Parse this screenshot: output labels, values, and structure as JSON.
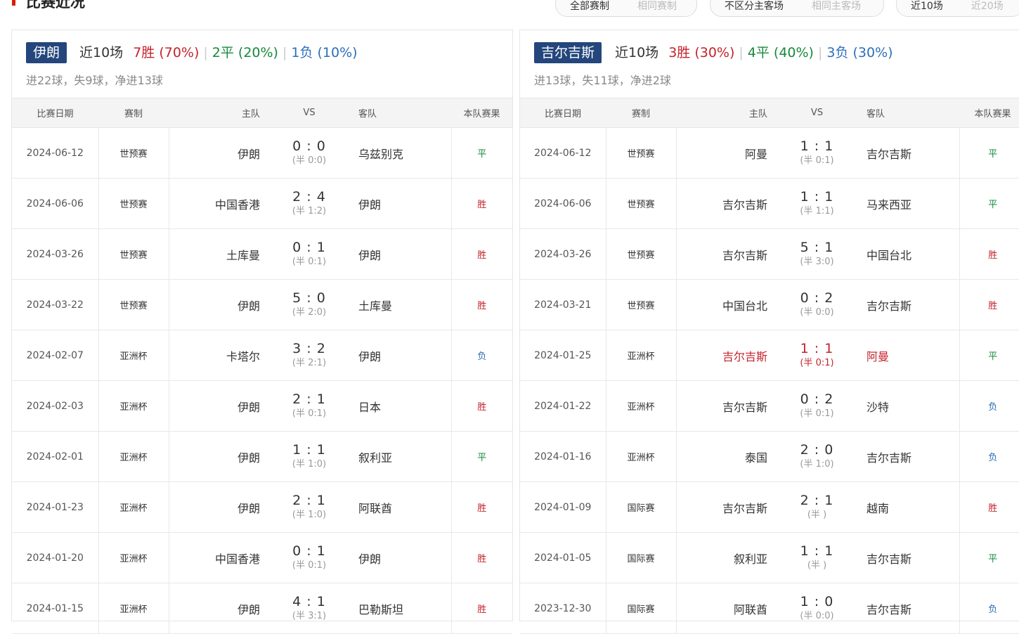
{
  "section_title": "比赛近况",
  "filters": {
    "group1": [
      "全部赛制",
      "相同赛制"
    ],
    "group2": [
      "不区分主客场",
      "相同主客场"
    ],
    "group3": [
      "近10场",
      "近20场"
    ]
  },
  "colors": {
    "win": "#c4232c",
    "draw": "#16893c",
    "loss": "#2d6fb8",
    "badge": "#24467c",
    "accent": "#d81e06"
  },
  "columns": {
    "date": "比赛日期",
    "comp": "赛制",
    "home": "主队",
    "vs": "VS",
    "away": "客队",
    "result": "本队赛果"
  },
  "left": {
    "team": "伊朗",
    "recent": "近10场",
    "wins": "7胜 (70%)",
    "draws": "2平 (20%)",
    "losses": "1负 (10%)",
    "goals": "进22球，失9球，净进13球",
    "matches": [
      {
        "date": "2024-06-12",
        "comp": "世预赛",
        "home": "伊朗",
        "score": "0 : 0",
        "half": "(半 0:0)",
        "away": "乌兹别克",
        "result": "平",
        "type": "draw"
      },
      {
        "date": "2024-06-06",
        "comp": "世预赛",
        "home": "中国香港",
        "score": "2 : 4",
        "half": "(半 1:2)",
        "away": "伊朗",
        "result": "胜",
        "type": "win"
      },
      {
        "date": "2024-03-26",
        "comp": "世预赛",
        "home": "土库曼",
        "score": "0 : 1",
        "half": "(半 0:1)",
        "away": "伊朗",
        "result": "胜",
        "type": "win"
      },
      {
        "date": "2024-03-22",
        "comp": "世预赛",
        "home": "伊朗",
        "score": "5 : 0",
        "half": "(半 2:0)",
        "away": "土库曼",
        "result": "胜",
        "type": "win"
      },
      {
        "date": "2024-02-07",
        "comp": "亚洲杯",
        "home": "卡塔尔",
        "score": "3 : 2",
        "half": "(半 2:1)",
        "away": "伊朗",
        "result": "负",
        "type": "loss"
      },
      {
        "date": "2024-02-03",
        "comp": "亚洲杯",
        "home": "伊朗",
        "score": "2 : 1",
        "half": "(半 0:1)",
        "away": "日本",
        "result": "胜",
        "type": "win"
      },
      {
        "date": "2024-02-01",
        "comp": "亚洲杯",
        "home": "伊朗",
        "score": "1 : 1",
        "half": "(半 1:0)",
        "away": "叙利亚",
        "result": "平",
        "type": "draw"
      },
      {
        "date": "2024-01-23",
        "comp": "亚洲杯",
        "home": "伊朗",
        "score": "2 : 1",
        "half": "(半 1:0)",
        "away": "阿联酋",
        "result": "胜",
        "type": "win"
      },
      {
        "date": "2024-01-20",
        "comp": "亚洲杯",
        "home": "中国香港",
        "score": "0 : 1",
        "half": "(半 0:1)",
        "away": "伊朗",
        "result": "胜",
        "type": "win"
      },
      {
        "date": "2024-01-15",
        "comp": "亚洲杯",
        "home": "伊朗",
        "score": "4 : 1",
        "half": "(半 3:1)",
        "away": "巴勒斯坦",
        "result": "胜",
        "type": "win"
      }
    ]
  },
  "right": {
    "team": "吉尔吉斯",
    "recent": "近10场",
    "wins": "3胜 (30%)",
    "draws": "4平 (40%)",
    "losses": "3负 (30%)",
    "goals": "进13球，失11球，净进2球",
    "matches": [
      {
        "date": "2024-06-12",
        "comp": "世预赛",
        "home": "阿曼",
        "score": "1 : 1",
        "half": "(半 0:1)",
        "away": "吉尔吉斯",
        "result": "平",
        "type": "draw"
      },
      {
        "date": "2024-06-06",
        "comp": "世预赛",
        "home": "吉尔吉斯",
        "score": "1 : 1",
        "half": "(半 1:1)",
        "away": "马来西亚",
        "result": "平",
        "type": "draw"
      },
      {
        "date": "2024-03-26",
        "comp": "世预赛",
        "home": "吉尔吉斯",
        "score": "5 : 1",
        "half": "(半 3:0)",
        "away": "中国台北",
        "result": "胜",
        "type": "win"
      },
      {
        "date": "2024-03-21",
        "comp": "世预赛",
        "home": "中国台北",
        "score": "0 : 2",
        "half": "(半 0:0)",
        "away": "吉尔吉斯",
        "result": "胜",
        "type": "win"
      },
      {
        "date": "2024-01-25",
        "comp": "亚洲杯",
        "home": "吉尔吉斯",
        "score": "1 : 1",
        "half": "(半 0:1)",
        "away": "阿曼",
        "result": "平",
        "type": "draw",
        "highlight": true
      },
      {
        "date": "2024-01-22",
        "comp": "亚洲杯",
        "home": "吉尔吉斯",
        "score": "0 : 2",
        "half": "(半 0:1)",
        "away": "沙特",
        "result": "负",
        "type": "loss"
      },
      {
        "date": "2024-01-16",
        "comp": "亚洲杯",
        "home": "泰国",
        "score": "2 : 0",
        "half": "(半 1:0)",
        "away": "吉尔吉斯",
        "result": "负",
        "type": "loss"
      },
      {
        "date": "2024-01-09",
        "comp": "国际赛",
        "home": "吉尔吉斯",
        "score": "2 : 1",
        "half": "(半 )",
        "away": "越南",
        "result": "胜",
        "type": "win"
      },
      {
        "date": "2024-01-05",
        "comp": "国际赛",
        "home": "叙利亚",
        "score": "1 : 1",
        "half": "(半 )",
        "away": "吉尔吉斯",
        "result": "平",
        "type": "draw"
      },
      {
        "date": "2023-12-30",
        "comp": "国际赛",
        "home": "阿联酋",
        "score": "1 : 0",
        "half": "(半 0:0)",
        "away": "吉尔吉斯",
        "result": "负",
        "type": "loss"
      }
    ]
  }
}
